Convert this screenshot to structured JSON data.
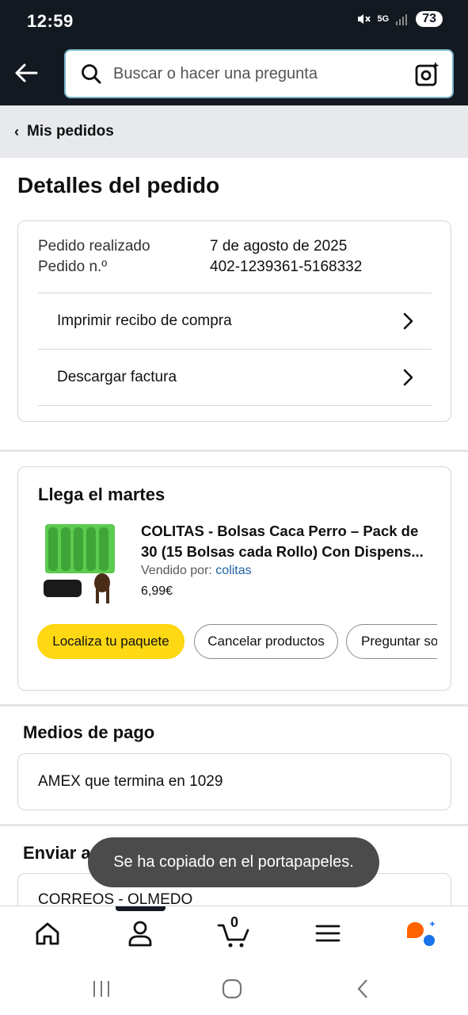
{
  "status": {
    "time": "12:59",
    "network": "5G",
    "battery": "73"
  },
  "search": {
    "placeholder": "Buscar o hacer una pregunta"
  },
  "breadcrumb": {
    "label": "Mis pedidos"
  },
  "page": {
    "title": "Detalles del pedido"
  },
  "order": {
    "placed_label": "Pedido realizado",
    "placed_value": "7 de agosto de 2025",
    "number_label": "Pedido n.º",
    "number_value": "402-1239361-5168332",
    "links": [
      "Imprimir recibo de compra",
      "Descargar factura"
    ]
  },
  "shipment": {
    "arrival": "Llega el martes",
    "product_title": "COLITAS - Bolsas Caca Perro – Pack de 30 (15 Bolsas cada Rollo) Con Dispens...",
    "seller_label": "Vendido por: ",
    "seller_name": "colitas",
    "price": "6,99€",
    "buttons": [
      "Localiza tu paquete",
      "Cancelar productos",
      "Preguntar so"
    ]
  },
  "payment": {
    "title": "Medios de pago",
    "method": "AMEX  que termina en 1029"
  },
  "shipping": {
    "title": "Enviar a",
    "address": "CORREOS - OLMEDO"
  },
  "toast": {
    "message": "Se ha copiado en el portapapeles."
  },
  "tabbar": {
    "items": [
      "home-icon",
      "account-icon",
      "cart-icon",
      "menu-icon",
      "rufus-icon"
    ],
    "cart_count": "0"
  },
  "colors": {
    "header": "#131921",
    "accent_yellow": "#ffd814",
    "link": "#2162a1"
  }
}
